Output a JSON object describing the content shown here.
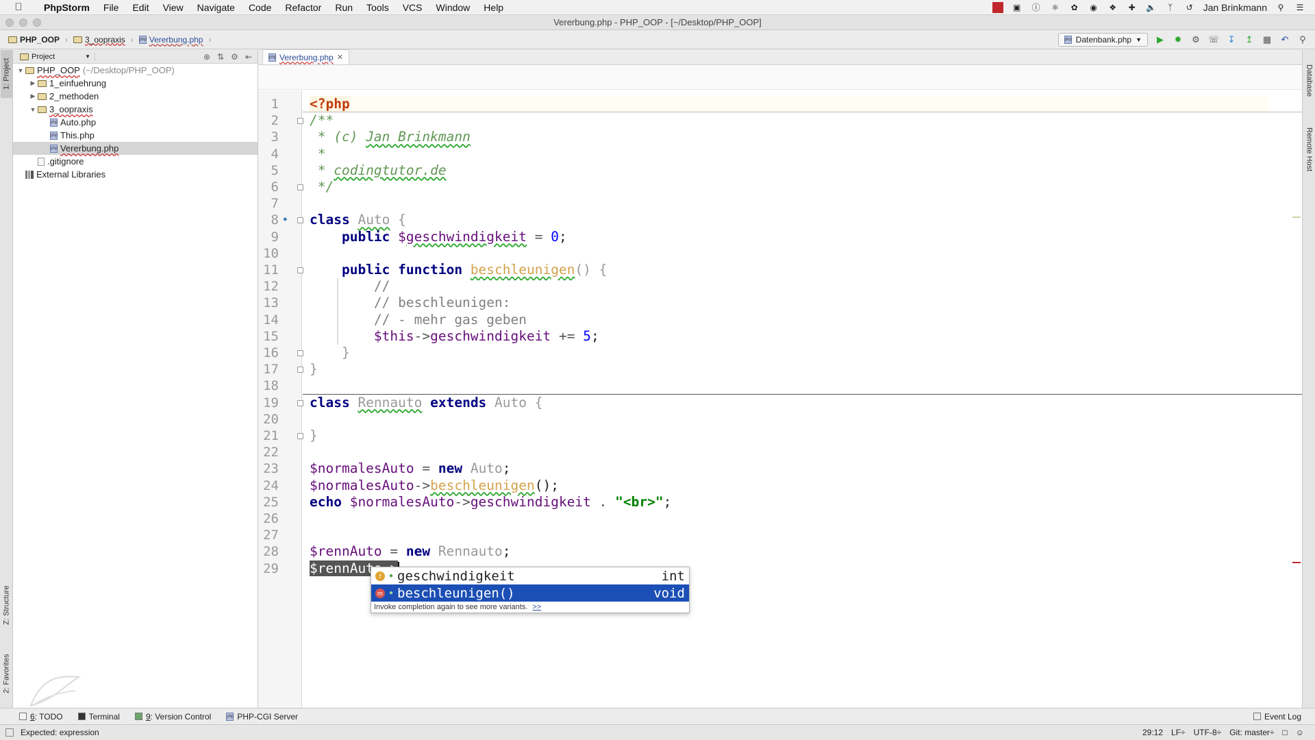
{
  "menubar": {
    "app_name": "PhpStorm",
    "items": [
      "File",
      "Edit",
      "View",
      "Navigate",
      "Code",
      "Refactor",
      "Run",
      "Tools",
      "VCS",
      "Window",
      "Help"
    ],
    "user": "Jan Brinkmann"
  },
  "window": {
    "title": "Vererbung.php - PHP_OOP - [~/Desktop/PHP_OOP]"
  },
  "breadcrumb": [
    "PHP_OOP",
    "3_oopraxis",
    "Vererbung.php"
  ],
  "toolbar": {
    "run_config": "Datenbank.php"
  },
  "tool_windows": {
    "left": [
      "1: Project",
      "Z: Structure",
      "2: Favorites"
    ],
    "right": [
      "Database",
      "Remote Host"
    ]
  },
  "project": {
    "header": "Project",
    "tree": [
      {
        "label": "PHP_OOP",
        "extra": "(~/Desktop/PHP_OOP)",
        "kind": "folder",
        "indent": 0,
        "arrow": "open"
      },
      {
        "label": "1_einfuehrung",
        "kind": "folder",
        "indent": 1,
        "arrow": "closed"
      },
      {
        "label": "2_methoden",
        "kind": "folder",
        "indent": 1,
        "arrow": "closed"
      },
      {
        "label": "3_oopraxis",
        "kind": "folder",
        "indent": 1,
        "arrow": "open"
      },
      {
        "label": "Auto.php",
        "kind": "php",
        "indent": 2
      },
      {
        "label": "This.php",
        "kind": "php",
        "indent": 2
      },
      {
        "label": "Vererbung.php",
        "kind": "php",
        "indent": 2,
        "selected": true
      },
      {
        "label": ".gitignore",
        "kind": "file",
        "indent": 1
      },
      {
        "label": "External Libraries",
        "kind": "lib",
        "indent": 0
      }
    ]
  },
  "editor": {
    "tab": "Vererbung.php",
    "lines": [
      [
        [
          "phptag",
          "<?php"
        ]
      ],
      [
        [
          "doc",
          "/**"
        ]
      ],
      [
        [
          "doc",
          " * (c) "
        ],
        [
          "docu",
          "Jan Brinkmann"
        ]
      ],
      [
        [
          "doc",
          " *"
        ]
      ],
      [
        [
          "doc",
          " * "
        ],
        [
          "docu",
          "codingtutor.de"
        ]
      ],
      [
        [
          "doc",
          " */"
        ]
      ],
      [
        [
          "",
          ""
        ]
      ],
      [
        [
          "kw",
          "class "
        ],
        [
          "clsu",
          "Auto"
        ],
        [
          "cls",
          " {"
        ]
      ],
      [
        [
          "",
          "    "
        ],
        [
          "kw",
          "public "
        ],
        [
          "var",
          "$"
        ],
        [
          "var vu",
          "geschwindigkeit"
        ],
        [
          "op",
          " = "
        ],
        [
          "num",
          "0"
        ],
        [
          "",
          ";"
        ]
      ],
      [
        [
          "",
          ""
        ]
      ],
      [
        [
          "",
          "    "
        ],
        [
          "kw",
          "public function "
        ],
        [
          "fn",
          "beschleunigen"
        ],
        [
          "cls",
          "() {"
        ]
      ],
      [
        [
          "cm",
          "        //"
        ]
      ],
      [
        [
          "cm",
          "        // beschleunigen:"
        ]
      ],
      [
        [
          "cm",
          "        // - mehr gas geben"
        ]
      ],
      [
        [
          "",
          "        "
        ],
        [
          "var",
          "$this"
        ],
        [
          "op",
          "->"
        ],
        [
          "var",
          "geschwindigkeit"
        ],
        [
          "op",
          " += "
        ],
        [
          "num",
          "5"
        ],
        [
          "",
          ";"
        ]
      ],
      [
        [
          "cls",
          "    }"
        ]
      ],
      [
        [
          "cls",
          "}"
        ]
      ],
      [
        [
          "",
          ""
        ]
      ],
      [
        [
          "kw",
          "class "
        ],
        [
          "clsu",
          "Rennauto"
        ],
        [
          "kw",
          " extends "
        ],
        [
          "cls",
          "Auto {"
        ]
      ],
      [
        [
          "",
          ""
        ]
      ],
      [
        [
          "cls",
          "}"
        ]
      ],
      [
        [
          "",
          ""
        ]
      ],
      [
        [
          "var",
          "$normalesAuto"
        ],
        [
          "op",
          " = "
        ],
        [
          "kw",
          "new "
        ],
        [
          "cls",
          "Auto"
        ],
        [
          "",
          ";"
        ]
      ],
      [
        [
          "var",
          "$normalesAuto"
        ],
        [
          "op",
          "->"
        ],
        [
          "fn",
          "beschleunigen"
        ],
        [
          "",
          "();"
        ]
      ],
      [
        [
          "kw",
          "echo "
        ],
        [
          "var",
          "$normalesAuto"
        ],
        [
          "op",
          "->"
        ],
        [
          "var",
          "geschwindigkeit"
        ],
        [
          "op",
          " . "
        ],
        [
          "str",
          "\"<br>\""
        ],
        [
          "",
          ";"
        ]
      ],
      [
        [
          "",
          ""
        ]
      ],
      [
        [
          "",
          ""
        ]
      ],
      [
        [
          "var",
          "$rennAuto"
        ],
        [
          "op",
          " = "
        ],
        [
          "kw",
          "new "
        ],
        [
          "cls",
          "Rennauto"
        ],
        [
          "",
          ";"
        ]
      ],
      [
        [
          "sel-hl",
          "$rennAuto->"
        ]
      ]
    ]
  },
  "completion": {
    "items": [
      {
        "name": "geschwindigkeit",
        "type": "int",
        "icon": "f"
      },
      {
        "name": "beschleunigen()",
        "type": "void",
        "icon": "m",
        "selected": true
      }
    ],
    "hint": "Invoke completion again to see more variants.",
    "more": ">>"
  },
  "bottom_tools": [
    {
      "key": "6",
      "label": ": TODO"
    },
    {
      "key": "",
      "label": "Terminal"
    },
    {
      "key": "9",
      "label": ": Version Control"
    },
    {
      "key": "",
      "label": "PHP-CGI Server"
    }
  ],
  "event_log": "Event Log",
  "status": {
    "message": "Expected: expression",
    "position": "29:12",
    "line_sep": "LF÷",
    "encoding": "UTF-8÷",
    "git": "Git: master÷"
  },
  "colors": {
    "selection": "#1c4fb5",
    "keyword": "#000080",
    "variable": "#660e7a",
    "doc": "#629755"
  }
}
